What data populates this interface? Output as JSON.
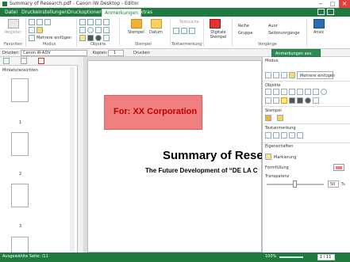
{
  "window": {
    "title": "Summary of Research.pdf - Canon iW Desktop - Editor",
    "minimize": "−",
    "maximize": "□",
    "close": "✕"
  },
  "menu": {
    "tabs": [
      "Datei",
      "Druckeinstellungen",
      "Druckoptionen",
      "Anmerkungen",
      "Extras"
    ],
    "active": "Anmerkungen"
  },
  "ribbon": {
    "register": "Register",
    "mehrere": "Mehrere einfügen",
    "stempel": "Stempel",
    "datum": "Datum",
    "textsuche": "Textsuche",
    "digitale_stempel": "Digitale Stempel",
    "reihe": "Reihe",
    "gruppe": "Gruppe",
    "auor": "Auor",
    "seitenvorgaenge": "Seitenvorgänge",
    "ansic": "Ansic",
    "groups": {
      "favoriten": "Favoriten",
      "modus": "Modus",
      "objekte": "Objekte",
      "stempel": "Stempel",
      "textanmerkung": "Textanmerkung",
      "vorgaenge": "Vorgänge"
    }
  },
  "toolbar2": {
    "drucker_label": "Drucker:",
    "printer": "Canon iR-ADV",
    "kopien_label": "Kopien:",
    "kopien_value": "1",
    "drucken": "Drucken",
    "anmerkungen_ass": "Anmerkungen ass."
  },
  "left_panel": {
    "title": "Miniaturansichten",
    "pages": [
      "1",
      "2",
      "3"
    ]
  },
  "document": {
    "annotation_text": "For: XX Corporation",
    "title": "Summary of Rese",
    "subtitle": "The Future Development of “DE LA C"
  },
  "right_panel": {
    "modus": "Modus",
    "mehrere": "Mehrere einfügen",
    "objekte": "Objekte",
    "stempel": "Stempel",
    "textanmerkung": "Textanmerkung",
    "eigenschaften": "Eigenschaften",
    "markierung": "Markierung",
    "formfuellung": "Formfüllung",
    "transparenz": "Transparenz",
    "transparenz_value": "50",
    "transparenz_unit": "%"
  },
  "status": {
    "left": "Ausgewählte Seite: /11",
    "zoom": "100%",
    "page_box": "1 / 11"
  },
  "colors": {
    "brand_green": "#1f7a3f",
    "annotation_fill": "#f08080",
    "annotation_text": "#c00000"
  }
}
